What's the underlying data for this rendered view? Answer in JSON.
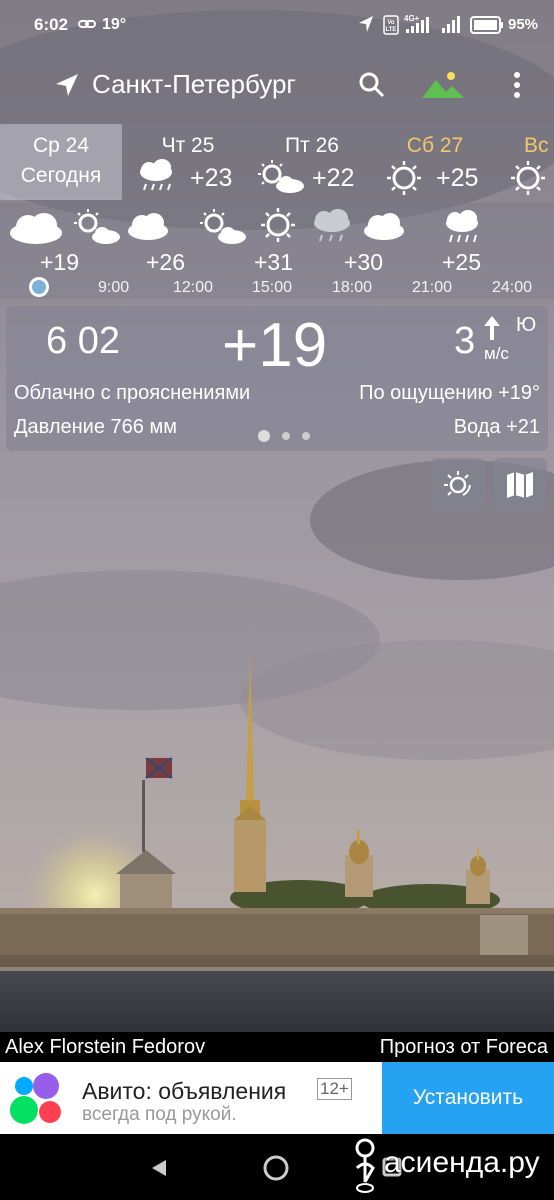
{
  "status_bar": {
    "time": "6:02",
    "temp": "19°",
    "battery": "95%"
  },
  "app_bar": {
    "city": "Санкт-Петербург",
    "icons": [
      "location-arrow-icon",
      "search-icon",
      "landscape-icon",
      "more-vert-icon"
    ]
  },
  "days": [
    {
      "name": "Ср 24",
      "sub": "Сегодня",
      "selected": true
    },
    {
      "name": "Чт 25",
      "temp": "+23",
      "icon": "rain-cloud-icon"
    },
    {
      "name": "Пт 26",
      "temp": "+22",
      "icon": "partly-cloudy-icon"
    },
    {
      "name": "Сб 27",
      "temp": "+25",
      "icon": "sun-icon",
      "color": "#f5c66b"
    },
    {
      "name": "Вс",
      "icon": "sun-icon",
      "color": "#f5c66b"
    }
  ],
  "hourly": {
    "temps": [
      "+19",
      "+26",
      "+31",
      "+30",
      "+25"
    ],
    "times": [
      "9:00",
      "12:00",
      "15:00",
      "18:00",
      "21:00",
      "24:00"
    ]
  },
  "current": {
    "time": "6 02",
    "temp": "+19",
    "wind_speed": "3",
    "wind_dir": "Ю",
    "wind_unit": "м/с",
    "description": "Облачно с прояснениями",
    "feels": "По ощущению +19°",
    "pressure": "Давление 766 мм",
    "water": "Вода +21"
  },
  "credits": {
    "photo": "Alex Florstein Fedorov",
    "forecast": "Прогноз от Foreca"
  },
  "ad": {
    "title": "Авито: объявления",
    "age": "12+",
    "subtitle": "всегда под рукой.",
    "button": "Установить"
  },
  "watermark": "асиенда.ру",
  "colors": {
    "accent": "#26a2f3",
    "weekend": "#f5c66b"
  }
}
